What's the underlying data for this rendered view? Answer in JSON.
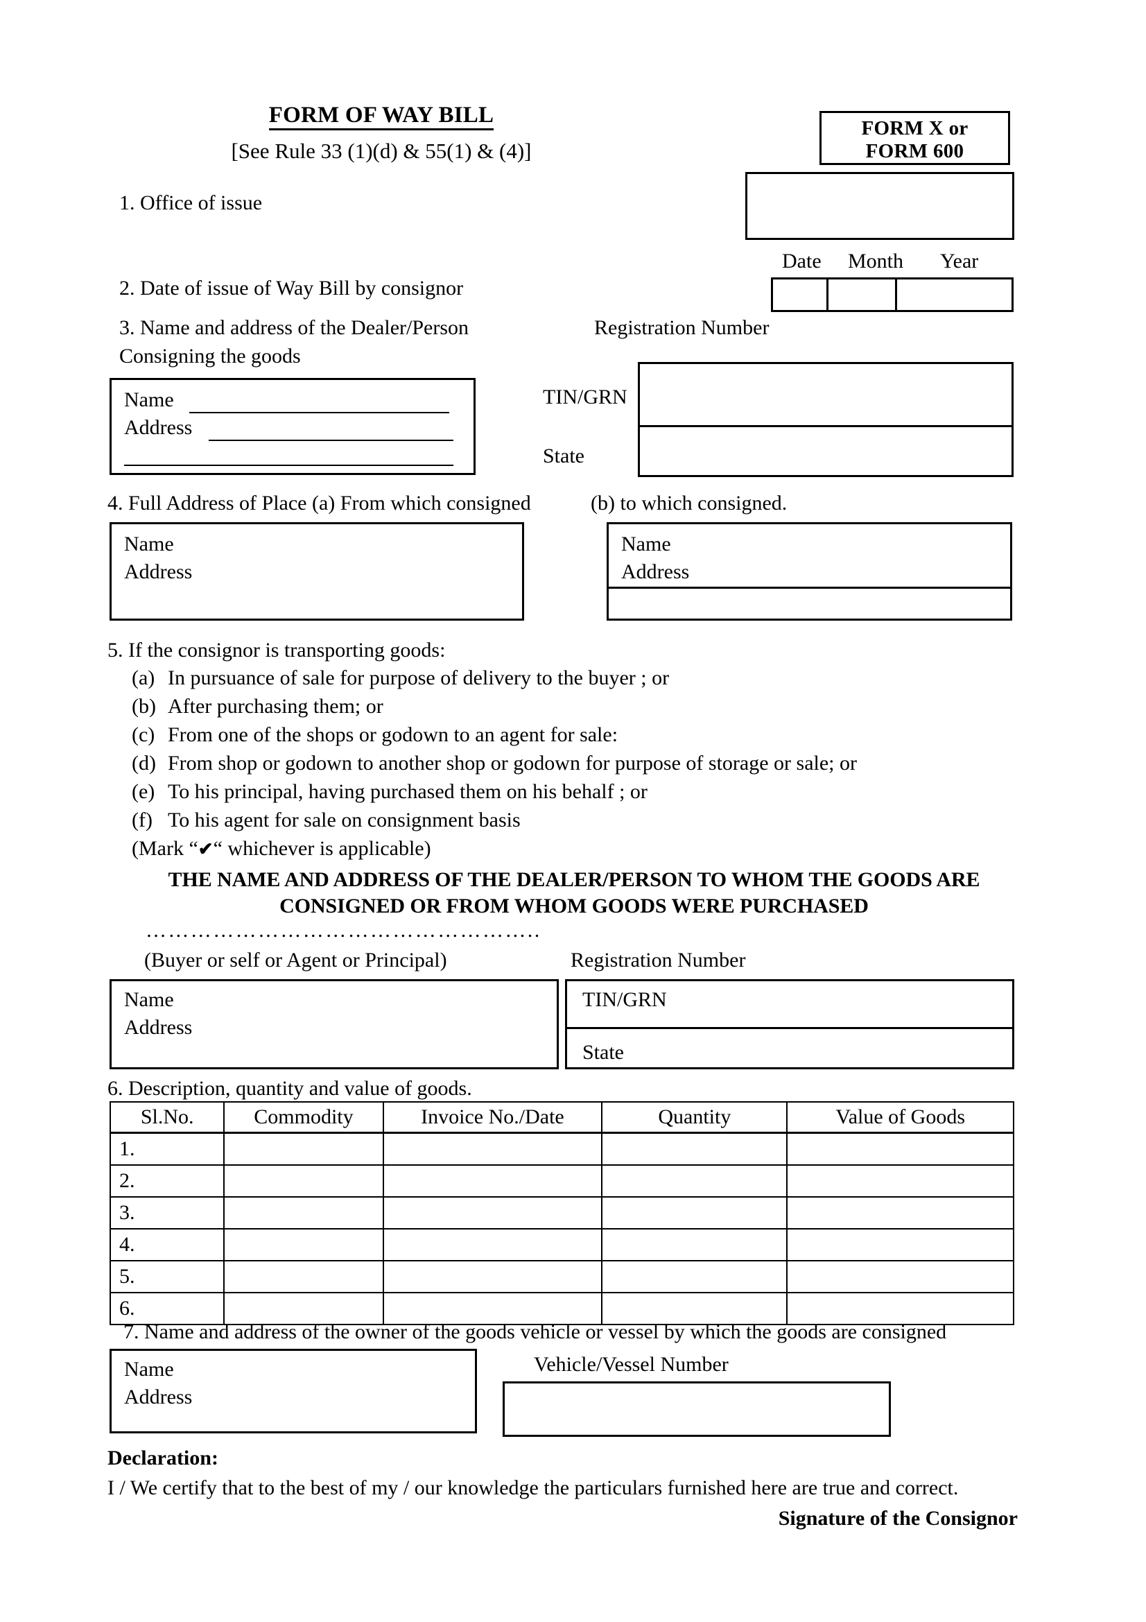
{
  "header": {
    "title": "FORM OF WAY BILL",
    "rule_reference": "[See Rule 33 (1)(d) & 55(1) & (4)]",
    "form_code_line1": "FORM X or",
    "form_code_line2": "FORM  600"
  },
  "date_fields": {
    "date_label": "Date",
    "month_label": "Month",
    "year_label": "Year"
  },
  "items": {
    "item1": "1. Office of issue",
    "item2": "2. Date of issue of Way Bill by consignor",
    "item3_line1": "3. Name and address of the Dealer/Person",
    "item3_line2": "Consigning the goods",
    "item4": "4. Full Address of Place (a) From which consigned",
    "item4b": "(b) to which consigned.",
    "item5_head": "5.  If the consignor is transporting goods:",
    "item6": "6.  Description, quantity and value of goods.",
    "item7": "7. Name and address of the owner of the goods vehicle or vessel by which the goods are consigned"
  },
  "labels": {
    "name": "Name",
    "address": "Address",
    "tin_grn": "TIN/GRN",
    "state": "State",
    "registration_number": "Registration Number",
    "vehicle_vessel_number": "Vehicle/Vessel Number",
    "buyer_caption": "(Buyer or self or Agent or Principal)",
    "dots": "……………………………………………..",
    "underscore_name": "________________________",
    "underscore_address": "______________________",
    "underscore_blank": "_______________________________"
  },
  "transport_purposes": [
    {
      "marker": "(a)",
      "text": "In pursuance of sale for purpose of delivery to the buyer ; or"
    },
    {
      "marker": "(b)",
      "text": "After purchasing them; or"
    },
    {
      "marker": "(c)",
      "text": "From one of the shops or godown to an agent for sale:"
    },
    {
      "marker": "(d)",
      "text": "From shop or godown to another shop or godown for purpose of storage or sale; or"
    },
    {
      "marker": "(e)",
      "text": "To his principal, having purchased them on his behalf ; or"
    },
    {
      "marker": "(f)",
      "text": "To his agent for sale on consignment basis"
    }
  ],
  "mark_instruction": {
    "prefix": "(Mark “",
    "check_glyph": "✔",
    "suffix": "“ whichever is applicable)"
  },
  "consignee_heading": {
    "line1": "THE NAME AND ADDRESS OF THE DEALER/PERSON TO WHOM THE GOODS ARE",
    "line2": "CONSIGNED OR FROM WHOM GOODS WERE PURCHASED"
  },
  "goods_table": {
    "columns": [
      "Sl.No.",
      "Commodity",
      "Invoice No./Date",
      "Quantity",
      "Value of Goods"
    ],
    "rows": [
      {
        "sl_no": "1.",
        "commodity": "",
        "invoice": "",
        "quantity": "",
        "value": ""
      },
      {
        "sl_no": "2.",
        "commodity": "",
        "invoice": "",
        "quantity": "",
        "value": ""
      },
      {
        "sl_no": "3.",
        "commodity": "",
        "invoice": "",
        "quantity": "",
        "value": ""
      },
      {
        "sl_no": "4.",
        "commodity": "",
        "invoice": "",
        "quantity": "",
        "value": ""
      },
      {
        "sl_no": "5.",
        "commodity": "",
        "invoice": "",
        "quantity": "",
        "value": ""
      },
      {
        "sl_no": "6.",
        "commodity": "",
        "invoice": "",
        "quantity": "",
        "value": ""
      }
    ]
  },
  "declaration": {
    "heading": "Declaration:",
    "text": "I / We certify that to the best of my / our knowledge the  particulars  furnished  here are  true and correct.",
    "signature": "Signature of the Consignor"
  }
}
